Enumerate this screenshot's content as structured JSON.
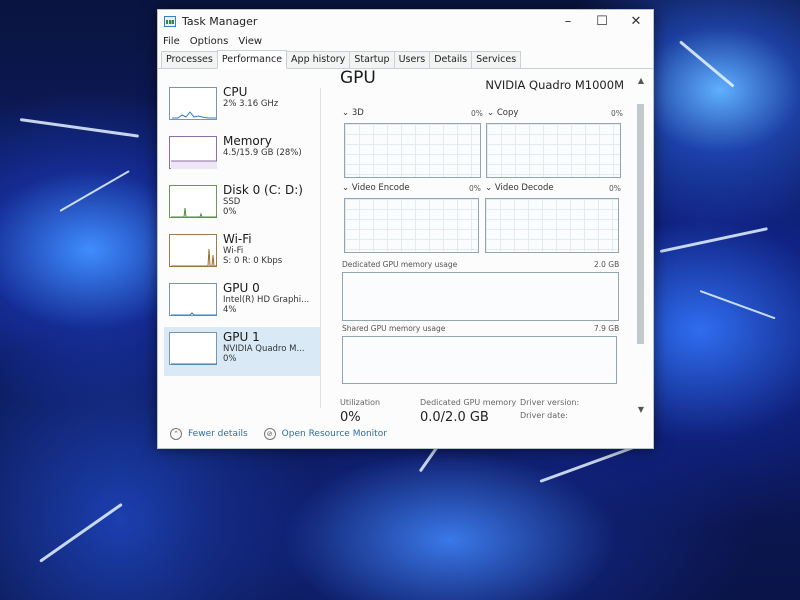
{
  "window": {
    "title": "Task Manager",
    "controls": {
      "minimize": "–",
      "maximize": "☐",
      "close": "✕"
    }
  },
  "menu": [
    "File",
    "Options",
    "View"
  ],
  "tabs": [
    "Processes",
    "Performance",
    "App history",
    "Startup",
    "Users",
    "Details",
    "Services"
  ],
  "sidebar": {
    "items": [
      {
        "name": "CPU",
        "sub1": "2% 3.16 GHz",
        "sub2": "",
        "sub3": ""
      },
      {
        "name": "Memory",
        "sub1": "4.5/15.9 GB (28%)",
        "sub2": "",
        "sub3": ""
      },
      {
        "name": "Disk 0 (C: D:)",
        "sub1": "SSD",
        "sub2": "0%",
        "sub3": ""
      },
      {
        "name": "Wi-Fi",
        "sub1": "Wi-Fi",
        "sub2": "S: 0 R: 0 Kbps",
        "sub3": ""
      },
      {
        "name": "GPU 0",
        "sub1": "Intel(R) HD Graphi...",
        "sub2": "4%",
        "sub3": ""
      },
      {
        "name": "GPU 1",
        "sub1": "NVIDIA Quadro M...",
        "sub2": "0%",
        "sub3": ""
      }
    ]
  },
  "main": {
    "title": "GPU",
    "model": "NVIDIA Quadro M1000M",
    "engines": [
      {
        "label": "3D",
        "value": "0%"
      },
      {
        "label": "Copy",
        "value": "0%"
      },
      {
        "label": "Video Encode",
        "value": "0%"
      },
      {
        "label": "Video Decode",
        "value": "0%"
      }
    ],
    "dedicated": {
      "label": "Dedicated GPU memory usage",
      "max": "2.0 GB"
    },
    "shared": {
      "label": "Shared GPU memory usage",
      "max": "7.9 GB"
    },
    "stats": [
      {
        "label": "Utilization",
        "value": "0%"
      },
      {
        "label": "Dedicated GPU memory",
        "value": "0.0/2.0 GB"
      },
      {
        "label": "Driver version:",
        "value": ""
      },
      {
        "label": "Driver date:",
        "value": ""
      }
    ]
  },
  "footer": {
    "fewer_details": "Fewer details",
    "open_monitor": "Open Resource Monitor"
  }
}
